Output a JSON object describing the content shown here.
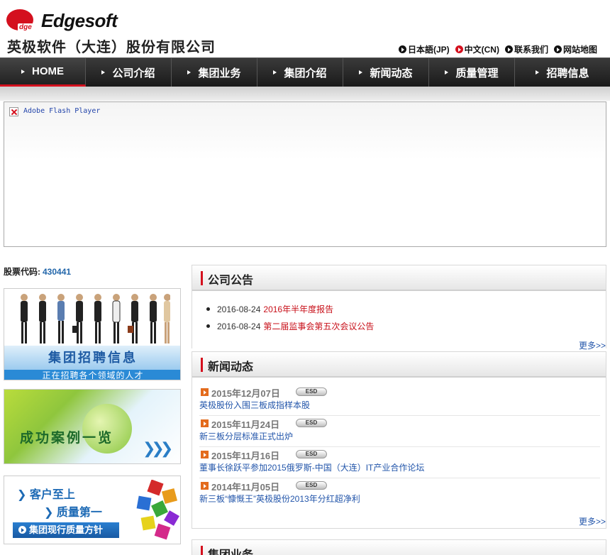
{
  "header": {
    "logo_mark": "dge",
    "logo_text": "Edgesoft",
    "company_name": "英极软件（大连）股份有限公司",
    "top_links": [
      {
        "label": "日本語(JP)",
        "icon": "play-circle-icon"
      },
      {
        "label": "中文(CN)",
        "icon": "play-circle-icon",
        "color": "#d4101e"
      },
      {
        "label": "联系我们",
        "icon": "play-circle-icon"
      },
      {
        "label": "网站地图",
        "icon": "play-circle-icon"
      }
    ]
  },
  "nav": {
    "items": [
      {
        "label": "HOME",
        "active": true
      },
      {
        "label": "公司介绍"
      },
      {
        "label": "集团业务"
      },
      {
        "label": "集团介绍"
      },
      {
        "label": "新闻动态"
      },
      {
        "label": "质量管理"
      },
      {
        "label": "招聘信息"
      }
    ]
  },
  "flash": {
    "label": "Adobe Flash Player",
    "icon": "broken-plugin-icon"
  },
  "stock": {
    "label": "股票代码:",
    "code": "430441"
  },
  "banners": {
    "recruit": {
      "title": "集团招聘信息",
      "subtitle": "正在招聘各个领域的人才"
    },
    "cases": {
      "title": "成功案例一览"
    },
    "quality": {
      "line1": "客户至上",
      "line2": "质量第一",
      "button": "集团现行质量方针"
    }
  },
  "notice": {
    "title": "公司公告",
    "items": [
      {
        "date": "2016-08-24",
        "title": "2016年半年度报告"
      },
      {
        "date": "2016-08-24",
        "title": "第二届监事会第五次会议公告"
      }
    ],
    "more": "更多>>"
  },
  "news": {
    "title": "新闻动态",
    "items": [
      {
        "date": "2015年12月07日",
        "tag": "ESD",
        "title": "英极股份入围三板成指样本股"
      },
      {
        "date": "2015年11月24日",
        "tag": "ESD",
        "title": "新三板分层标准正式出炉"
      },
      {
        "date": "2015年11月16日",
        "tag": "ESD",
        "title": "董事长徐跃平参加2015俄罗斯-中国（大连）IT产业合作论坛"
      },
      {
        "date": "2014年11月05日",
        "tag": "ESD",
        "title": "新三板“慷慨王”英极股份2013年分红超净利"
      }
    ],
    "more": "更多>>"
  },
  "business": {
    "title": "集团业务"
  },
  "colors": {
    "brand_red": "#d4101e",
    "link_blue": "#2255aa",
    "nav_bg": "#2a2a2a"
  }
}
